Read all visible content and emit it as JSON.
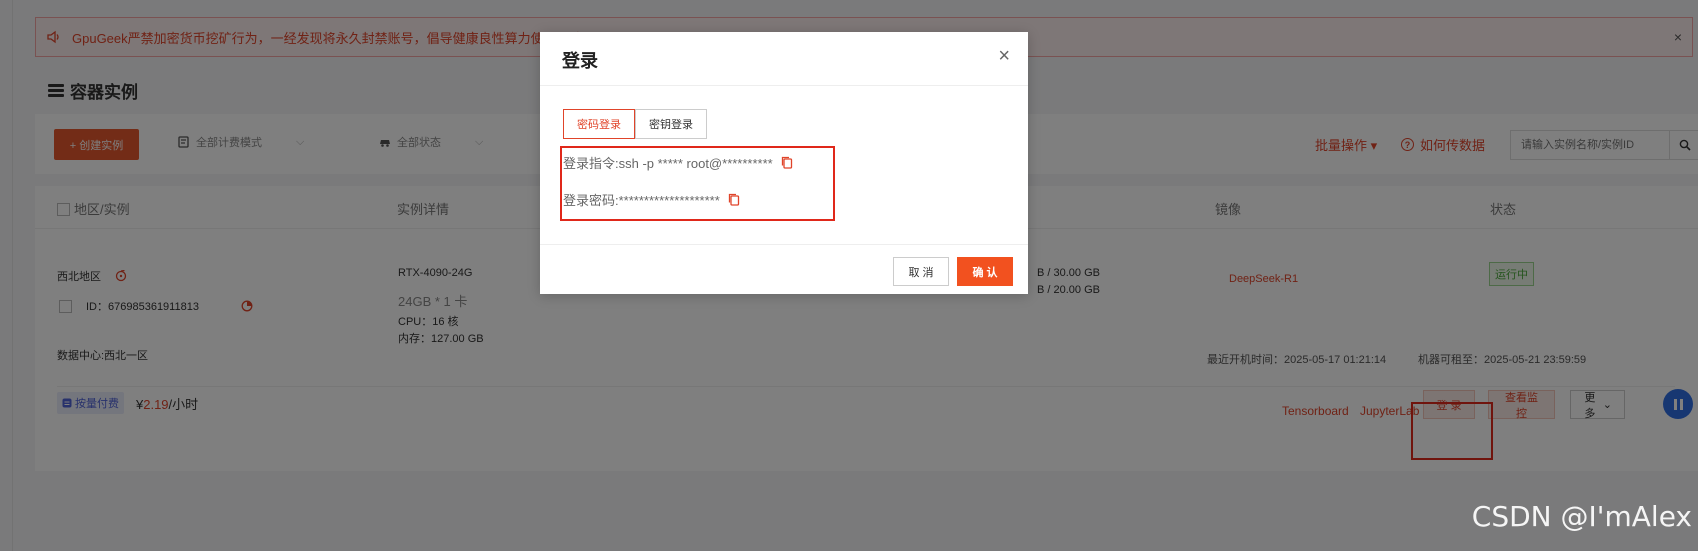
{
  "alert": {
    "text": "GpuGeek严禁加密货币挖矿行为，一经发现将永久封禁账号，倡导健康良性算力使用环境。",
    "close_glyph": "×"
  },
  "header": {
    "title": "容器实例"
  },
  "toolbar": {
    "create_label": "+ 创建实例",
    "billing_filter": "全部计费模式",
    "status_filter": "全部状态",
    "batch_label": "批量操作 ▾",
    "how_data_label": "如何传数据",
    "search_placeholder": "请输入实例名称/实例ID"
  },
  "table": {
    "columns": {
      "region": "地区/实例",
      "detail": "实例详情",
      "image": "镜像",
      "status": "状态"
    }
  },
  "instance": {
    "region": "西北地区",
    "id_label": "ID：676985361911813",
    "datacenter": "数据中心:西北一区",
    "gpu": "RTX-4090-24G",
    "gpu_mem": "24GB * 1 卡",
    "cpu": "CPU：16 核",
    "memory": "内存：127.00 GB",
    "disk1": "B / 30.00 GB",
    "disk2": "B / 20.00 GB",
    "image": "DeepSeek-R1",
    "status": "运行中",
    "last_boot": "最近开机时间：2025-05-17 01:21:14",
    "rent_until": "机器可租至：2025-05-21 23:59:59",
    "billing": "按量付费",
    "price_prefix": "¥",
    "price_amount": "2.19",
    "price_unit": "/小时",
    "link_tensorboard": "Tensorboard",
    "link_jupyter": "JupyterLab",
    "login_btn": "登 录",
    "monitor_btn": "查看监控",
    "more_btn": "更多"
  },
  "modal": {
    "title": "登录",
    "close_glyph": "×",
    "tabs": [
      "密码登录",
      "密钥登录"
    ],
    "command_line": "登录指令:ssh -p ***** root@**********",
    "password_line": "登录密码:********************",
    "cancel": "取 消",
    "confirm": "确 认"
  },
  "watermark": "CSDN @I'mAlex",
  "colors": {
    "accent": "#e0442a",
    "confirm": "#f2511f",
    "status_green": "#4aa83a",
    "pause_blue": "#2f6fe5",
    "highlight_frame": "#e0281a"
  }
}
